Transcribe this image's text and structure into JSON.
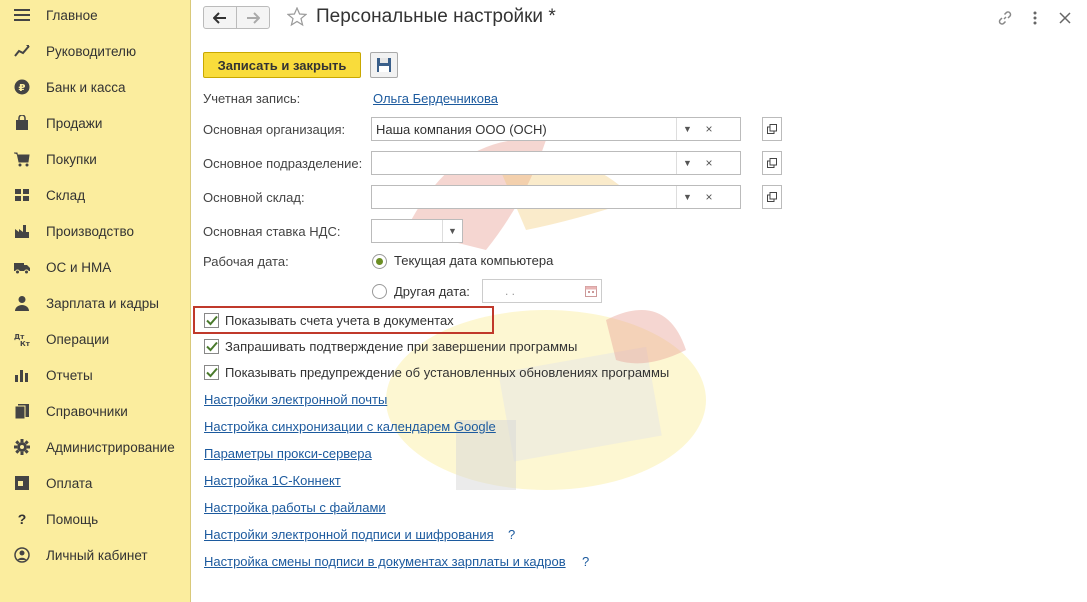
{
  "sidebar": {
    "items": [
      {
        "label": "Главное",
        "icon": "menu-icon"
      },
      {
        "label": "Руководителю",
        "icon": "chart-line-icon"
      },
      {
        "label": "Банк и касса",
        "icon": "ruble-icon"
      },
      {
        "label": "Продажи",
        "icon": "bag-icon"
      },
      {
        "label": "Покупки",
        "icon": "cart-icon"
      },
      {
        "label": "Склад",
        "icon": "warehouse-icon"
      },
      {
        "label": "Производство",
        "icon": "factory-icon"
      },
      {
        "label": "ОС и НМА",
        "icon": "truck-icon"
      },
      {
        "label": "Зарплата и кадры",
        "icon": "person-icon"
      },
      {
        "label": "Операции",
        "icon": "dt-kt-icon"
      },
      {
        "label": "Отчеты",
        "icon": "bar-chart-icon"
      },
      {
        "label": "Справочники",
        "icon": "book-icon"
      },
      {
        "label": "Администрирование",
        "icon": "gear-icon"
      },
      {
        "label": "Оплата",
        "icon": "payment-icon"
      },
      {
        "label": "Помощь",
        "icon": "question-icon"
      },
      {
        "label": "Личный кабинет",
        "icon": "user-circle-icon"
      }
    ]
  },
  "header": {
    "title": "Персональные настройки *"
  },
  "toolbar": {
    "save_close_label": "Записать и закрыть"
  },
  "form": {
    "account_label": "Учетная запись:",
    "account_value": "Ольга Бердечникова",
    "org_label": "Основная организация:",
    "org_value": "Наша компания ООО (ОСН)",
    "dept_label": "Основное подразделение:",
    "dept_value": "",
    "warehouse_label": "Основной склад:",
    "warehouse_value": "",
    "vat_label": "Основная ставка НДС:",
    "vat_value": "",
    "workdate_label": "Рабочая дата:",
    "radio_current": "Текущая дата компьютера",
    "radio_other": "Другая дата:",
    "other_date_value": ". .",
    "selected_radio": "current"
  },
  "checkboxes": [
    {
      "label": "Показывать счета учета в документах",
      "checked": true
    },
    {
      "label": "Запрашивать подтверждение при завершении программы",
      "checked": true
    },
    {
      "label": "Показывать предупреждение об установленных обновлениях программы",
      "checked": true
    }
  ],
  "links": [
    {
      "label": "Настройки электронной почты",
      "help": ""
    },
    {
      "label": "Настройка синхронизации с календарем Google",
      "help": ""
    },
    {
      "label": "Параметры прокси-сервера",
      "help": ""
    },
    {
      "label": "Настройка 1С-Коннект",
      "help": ""
    },
    {
      "label": "Настройка работы с файлами",
      "help": ""
    },
    {
      "label": "Настройки электронной подписи и шифрования",
      "help": "?"
    },
    {
      "label": "Настройка смены подписи в документах зарплаты и кадров",
      "help": "?"
    }
  ],
  "colors": {
    "sidebar_bg": "#fbed9e",
    "primary_button": "#f9dc3b",
    "link": "#1c5a9e",
    "highlight": "#c0392b",
    "check": "#4a7a2c"
  }
}
